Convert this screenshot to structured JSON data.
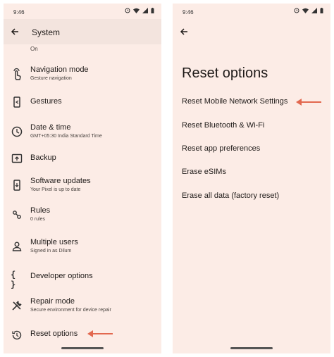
{
  "left_screen": {
    "status": {
      "time": "9:46"
    },
    "header": {
      "title": "System"
    },
    "items": [
      {
        "label": "",
        "sub": "On"
      },
      {
        "label": "Navigation mode",
        "sub": "Gesture navigation"
      },
      {
        "label": "Gestures",
        "sub": ""
      },
      {
        "label": "Date & time",
        "sub": "GMT+05:30 India Standard Time"
      },
      {
        "label": "Backup",
        "sub": ""
      },
      {
        "label": "Software updates",
        "sub": "Your Pixel is up to date"
      },
      {
        "label": "Rules",
        "sub": "0 rules"
      },
      {
        "label": "Multiple users",
        "sub": "Signed in as Dilum"
      },
      {
        "label": "Developer options",
        "sub": ""
      },
      {
        "label": "Repair mode",
        "sub": "Secure environment for device repair"
      },
      {
        "label": "Reset options",
        "sub": ""
      }
    ],
    "developer_icon_glyph": "{ }"
  },
  "right_screen": {
    "status": {
      "time": "9:46"
    },
    "title": "Reset options",
    "items": [
      "Reset Mobile Network Settings",
      "Reset Bluetooth & Wi-Fi",
      "Reset app preferences",
      "Erase eSIMs",
      "Erase all data (factory reset)"
    ]
  },
  "colors": {
    "background": "#fcece6",
    "header": "#f3e4de",
    "arrow": "#e2684f"
  }
}
